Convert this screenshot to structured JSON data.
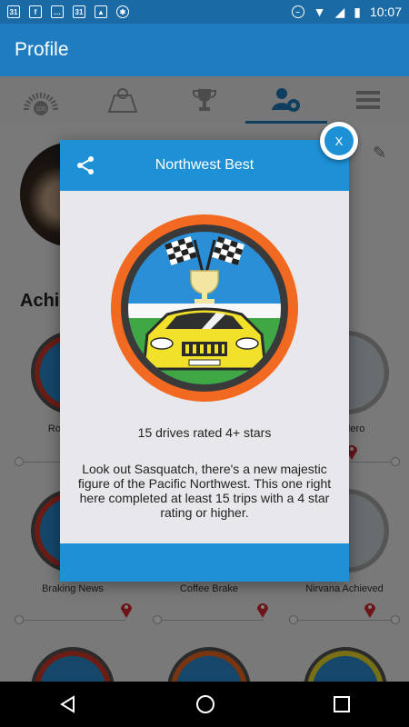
{
  "status_bar": {
    "time": "10:07",
    "calendar_day_1": "31",
    "calendar_day_2": "31",
    "icons": [
      "calendar-icon",
      "facebook-icon",
      "message-icon",
      "calendar-icon",
      "image-icon",
      "app-icon",
      "do-not-disturb-icon",
      "wifi-icon",
      "signal-icon",
      "battery-icon"
    ]
  },
  "app_bar": {
    "title": "Profile"
  },
  "tabs": [
    {
      "icon": "odometer-100-icon",
      "badge": "100"
    },
    {
      "icon": "map-icon"
    },
    {
      "icon": "trophy-icon"
    },
    {
      "icon": "profile-settings-icon",
      "active": true
    },
    {
      "icon": "menu-icon"
    }
  ],
  "achievements": {
    "title": "Achie",
    "row1_labels": [
      "Roa",
      "ro Hero"
    ],
    "row2_labels": [
      "Braking News",
      "Coffee Brake",
      "Nirvana Achieved"
    ]
  },
  "dialog": {
    "title": "Northwest Best",
    "subtitle": "15 drives rated 4+ stars",
    "description": "Look out Sasquatch, there's a new majestic figure of the Pacific Northwest. This one right here completed at least 15 trips with a 4 star rating or higher.",
    "close_label": "X"
  },
  "colors": {
    "primary": "#1f7cc0",
    "dialog_header": "#1e90d6",
    "badge_ring": "#f26a21",
    "car_yellow": "#f2e12a",
    "grass": "#3fa845",
    "sky": "#2a8fd6"
  }
}
